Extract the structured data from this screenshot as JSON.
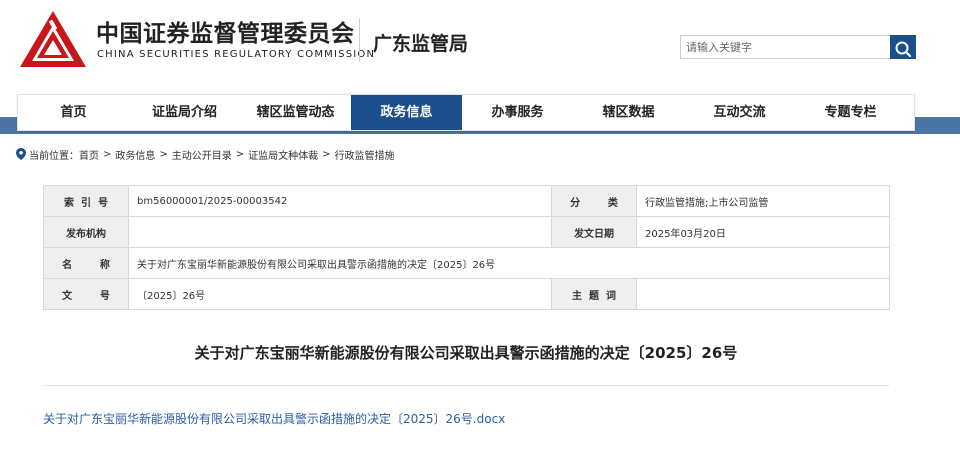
{
  "header": {
    "logo_cn": "中国证券监督管理委员会",
    "logo_en": "CHINA SECURITIES REGULATORY COMMISSION",
    "region": "广东监管局",
    "search": {
      "placeholder": "请输入关键字",
      "icon": "search-icon"
    },
    "logo_icon": "csrc-logo-icon",
    "brand_color": "#c8161d",
    "accent_color": "#1c4e8c"
  },
  "nav": {
    "items": [
      {
        "label": "首页",
        "active": false
      },
      {
        "label": "证监局介绍",
        "active": false
      },
      {
        "label": "辖区监管动态",
        "active": false
      },
      {
        "label": "政务信息",
        "active": true
      },
      {
        "label": "办事服务",
        "active": false
      },
      {
        "label": "辖区数据",
        "active": false
      },
      {
        "label": "互动交流",
        "active": false
      },
      {
        "label": "专题专栏",
        "active": false
      }
    ]
  },
  "breadcrumb": {
    "icon": "location-pin-icon",
    "prefix": "当前位置：",
    "items": [
      "首页",
      "政务信息",
      "主动公开目录",
      "证监局文种体裁",
      "行政监管措施"
    ],
    "separator": ">"
  },
  "info": {
    "index_label": "索  引  号",
    "index_value": "bm56000001/2025-00003542",
    "category_label": "分        类",
    "category_value": "行政监管措施;上市公司监管",
    "publisher_label": "发布机构",
    "publisher_value": "",
    "date_label": "发文日期",
    "date_value": "2025年03月20日",
    "name_label": "名        称",
    "name_value": "关于对广东宝丽华新能源股份有限公司采取出具警示函措施的决定〔2025〕26号",
    "docno_label": "文        号",
    "docno_value": "〔2025〕26号",
    "subject_label": "主  题  词",
    "subject_value": ""
  },
  "document": {
    "title": "关于对广东宝丽华新能源股份有限公司采取出具警示函措施的决定〔2025〕26号",
    "attachment": "关于对广东宝丽华新能源股份有限公司采取出具警示函措施的决定〔2025〕26号.docx"
  }
}
